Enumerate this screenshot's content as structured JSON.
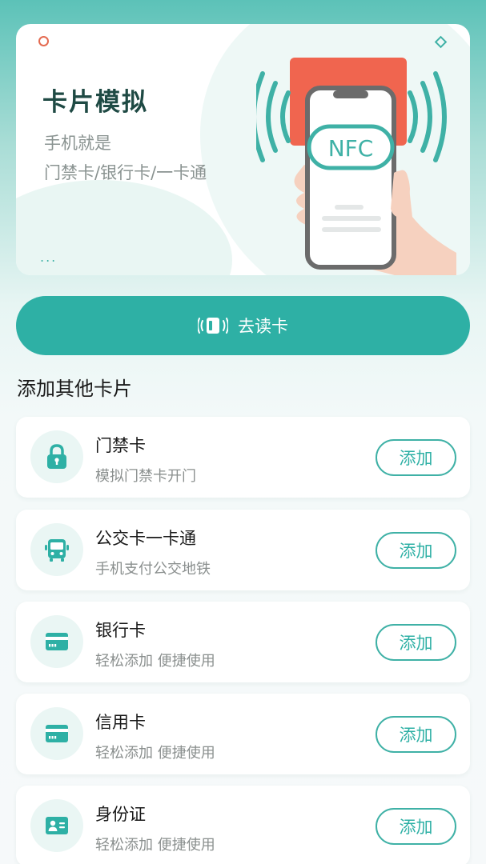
{
  "hero": {
    "title": "卡片模拟",
    "subtitle_line1": "手机就是",
    "subtitle_line2": "门禁卡/银行卡/一卡通",
    "nfc_label": "NFC",
    "dots": "..."
  },
  "read_button": {
    "label": "去读卡",
    "icon": "nfc-card-icon"
  },
  "section": {
    "title": "添加其他卡片"
  },
  "cards": [
    {
      "name": "门禁卡",
      "desc": "模拟门禁卡开门",
      "icon": "lock-icon",
      "button": "添加"
    },
    {
      "name": "公交卡一卡通",
      "desc": "手机支付公交地铁",
      "icon": "bus-icon",
      "button": "添加"
    },
    {
      "name": "银行卡",
      "desc": "轻松添加 便捷使用",
      "icon": "bank-card-icon",
      "button": "添加"
    },
    {
      "name": "信用卡",
      "desc": "轻松添加 便捷使用",
      "icon": "credit-card-icon",
      "button": "添加"
    },
    {
      "name": "身份证",
      "desc": "轻松添加 便捷使用",
      "icon": "id-card-icon",
      "button": "添加"
    }
  ],
  "colors": {
    "accent": "#2eb0a5",
    "accent_light": "#eaf6f4",
    "nfc_card": "#f0654f",
    "title_dark": "#1f4a44"
  }
}
